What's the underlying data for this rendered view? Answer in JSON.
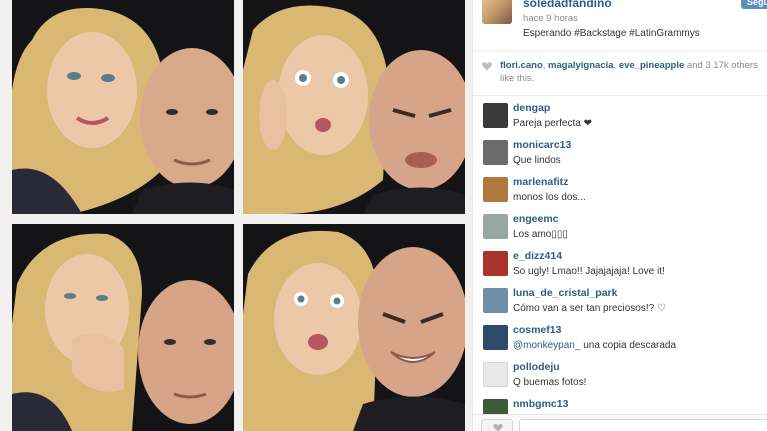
{
  "post": {
    "owner": "soledadfandino",
    "time": "hace 9 horas",
    "caption": "Esperando #Backstage #LatinGrammys",
    "follow_label": "Segu"
  },
  "likes": {
    "users": [
      "flori.cano",
      "magalyignacia",
      "eve_pineapple"
    ],
    "sep1": ", ",
    "sep2": ", ",
    "rest": " and 3.17k others",
    "tail": "like this."
  },
  "comments": [
    {
      "user": "dengap",
      "text": "Pareja perfecta ❤",
      "avatar": "#3a3a3a"
    },
    {
      "user": "monicarc13",
      "text": "Que lindos",
      "avatar": "#6b6b6b"
    },
    {
      "user": "marlenafitz",
      "text": "monos los dos...",
      "avatar": "#b07a3c"
    },
    {
      "user": "engeemc",
      "text": "Los amo▯▯▯",
      "avatar": "#9aa6a0"
    },
    {
      "user": "e_dizz414",
      "text": "So ugly! Lmao!! Jajajajaja! Love it!",
      "avatar": "#a8322c"
    },
    {
      "user": "luna_de_cristal_park",
      "text": "Cómo van a ser tan preciosos!? ♡",
      "avatar": "#6f8fa8"
    },
    {
      "user": "cosmef13",
      "mention": "@monkeypan_",
      "text": " una copia descarada",
      "avatar": "#2e4a6a"
    },
    {
      "user": "pollodeju",
      "text": "Q buemas fotos!",
      "avatar": "#e9e9e9"
    },
    {
      "user": "nmbgmc13",
      "text": "",
      "avatar": "#3d5c3a"
    }
  ],
  "colors": {
    "link": "#2d5d8a",
    "follow_button": "#5d8fbd",
    "photo_background": "#151517"
  },
  "icons": {
    "like": "heart-icon"
  }
}
